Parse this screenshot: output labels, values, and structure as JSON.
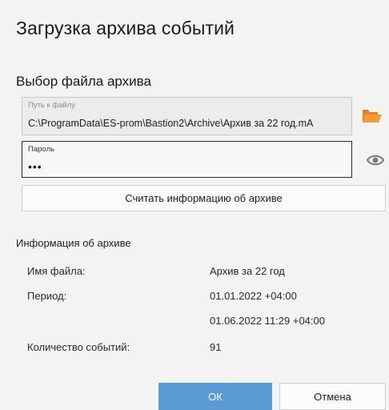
{
  "dialog": {
    "title": "Загрузка архива событий",
    "section_title": "Выбор файла архива"
  },
  "path_field": {
    "label": "Путь к файлу",
    "value": "C:\\ProgramData\\ES-prom\\Bastion2\\Archive\\Архив за 22 год.mA"
  },
  "password_field": {
    "label": "Пароль",
    "value": "•••"
  },
  "read_button": {
    "label": "Считать информацию об архиве"
  },
  "info": {
    "heading": "Информация об архиве",
    "rows": [
      {
        "label": "Имя файла:",
        "value": "Архив за 22 год"
      },
      {
        "label": "Период:",
        "value": "01.01.2022 +04:00"
      },
      {
        "label": "",
        "value": "01.06.2022 11:29 +04:00"
      },
      {
        "label": "Количество событий:",
        "value": "91"
      }
    ]
  },
  "buttons": {
    "ok": "ОК",
    "cancel": "Отмена"
  },
  "colors": {
    "accent": "#5b9bd5",
    "folder_icon": "#e8821e",
    "background": "#f3f3f3"
  },
  "icons": {
    "browse": "folder-open-icon",
    "reveal": "eye-icon"
  }
}
